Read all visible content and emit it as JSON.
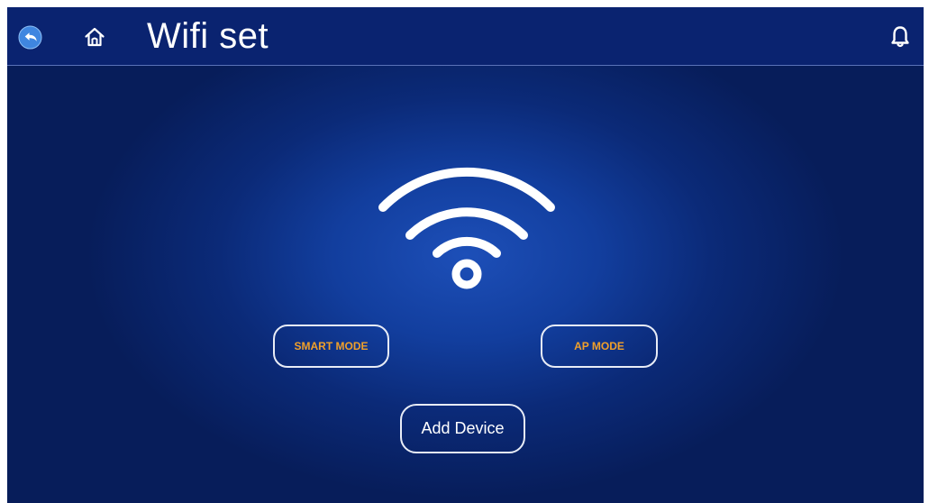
{
  "header": {
    "title": "Wifi set",
    "back_icon": "back-arrow-icon",
    "home_icon": "home-icon",
    "notification_icon": "bell-icon"
  },
  "main": {
    "status_icon": "wifi-icon",
    "smart_mode_label": "SMART MODE",
    "ap_mode_label": "AP MODE",
    "add_device_label": "Add Device"
  },
  "colors": {
    "background": "#0b2a78",
    "header_bar": "#0a2370",
    "mode_label": "#f0a02a",
    "text": "#ffffff"
  }
}
